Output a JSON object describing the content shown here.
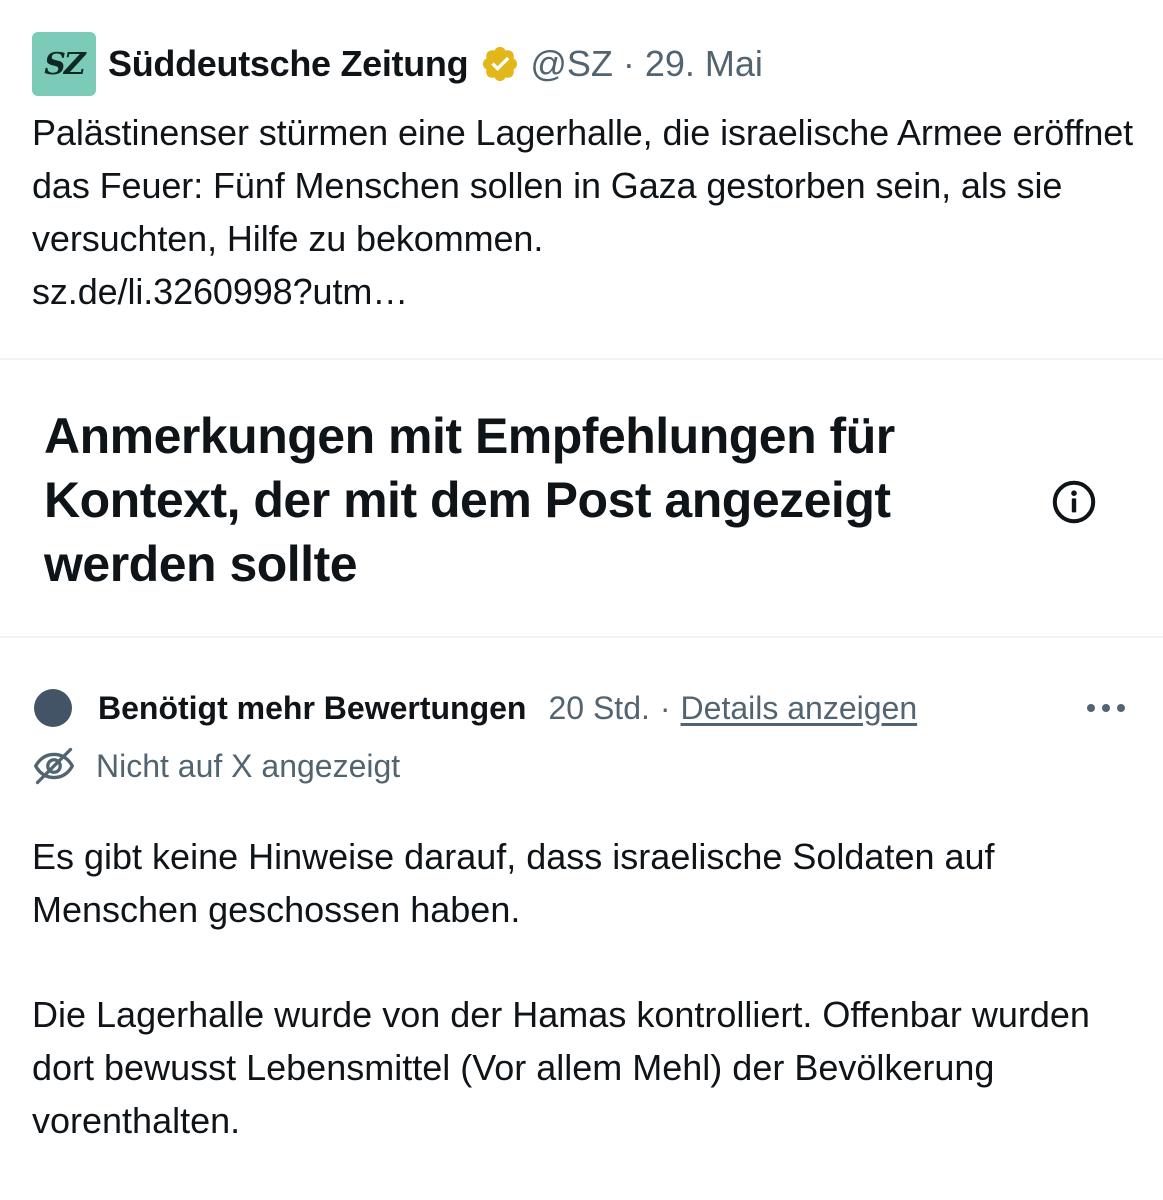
{
  "post": {
    "avatar_text": "SZ",
    "author_name": "Süddeutsche Zeitung",
    "handle": "@SZ",
    "separator": "·",
    "date": "29. Mai",
    "text": "Palästinenser stürmen eine Lagerhalle, die israelische Armee eröffnet das Feuer: Fünf Menschen sollen in Gaza gestorben sein, als sie versuchten, Hilfe zu bekommen.",
    "link": "sz.de/li.3260998?utm…"
  },
  "notes_section": {
    "heading": "Anmerkungen mit Empfehlungen für Kontext, der mit dem Post angezeigt werden sollte"
  },
  "note": {
    "status": "Benötigt mehr Bewertungen",
    "time": "20 Std.",
    "separator": "·",
    "details_link": "Details anzeigen",
    "visibility": "Nicht auf X angezeigt",
    "paragraphs": [
      "Es gibt keine Hinweise darauf, dass israelische Soldaten auf Menschen geschossen haben.",
      "Die Lagerhalle wurde von der Hamas kontrolliert. Offenbar wurden dort bewusst Lebensmittel (Vor allem Mehl) der Bevölkerung vorenthalten."
    ]
  },
  "icons": {
    "verified": "verified-badge-gold-icon",
    "info": "info-icon",
    "more": "more-horizontal-icon",
    "visibility": "eye-off-icon"
  },
  "colors": {
    "avatar_bg": "#7ccbb9",
    "verified_gold": "#e2b719",
    "secondary_text": "#536471",
    "status_dot": "#425466",
    "divider": "#eff3f4"
  }
}
